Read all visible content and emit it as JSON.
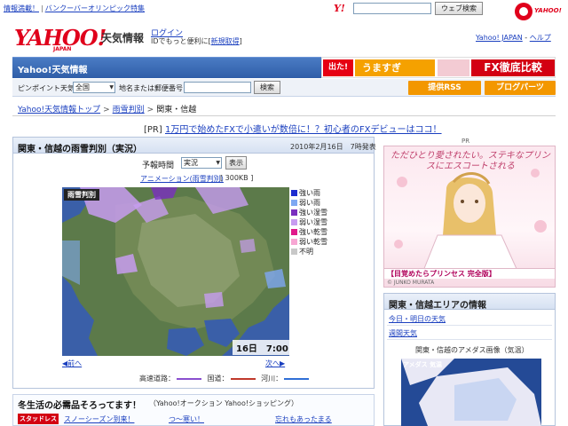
{
  "topbar": {
    "news": [
      "情報満載！",
      "バンクーバーオリンピック特集"
    ],
    "yahoo_small": "Y!",
    "search_button": "ウェブ検索",
    "logo_right_text": "YAHOO!"
  },
  "header": {
    "logo": "YAHOO!",
    "logo_sub": "JAPAN",
    "app_title": "天気情報",
    "login": "ログイン",
    "login_desc_prefix": "IDでもっと便利に[",
    "register": "新規取得",
    "login_desc_suffix": "]",
    "links": [
      "Yahoo! JAPAN",
      "ヘルプ"
    ]
  },
  "bluebar": {
    "title": "Yahoo!天気情報",
    "banner": [
      "出た!",
      "うますぎ",
      "",
      "FX徹底比較"
    ]
  },
  "search": {
    "pin_label": "ピンポイント天気",
    "region": "全国",
    "addr_label": "地名または郵便番号",
    "button": "検索",
    "rss": "提供RSS",
    "blog": "ブログパーツ"
  },
  "breadcrumb": {
    "items": [
      "Yahoo!天気情報トップ",
      "雨雪判別",
      "関東・信越"
    ]
  },
  "pr": {
    "tag": "[PR]",
    "text": "1万円で始めたFXで小遣いが数倍に！？初心者のFXデビューはココ！"
  },
  "panel": {
    "title": "関東・信越の雨雪判別（実況）",
    "date": "2010年2月16日　7時発表",
    "forecast_label": "予報時間",
    "time_value": "実況",
    "show_button": "表示",
    "anim_link": "アニメーション(雨雪判別)",
    "anim_size": "[ 300KB ]",
    "map_label": "雨雪判別",
    "map_time": "16日　7:00",
    "legend": [
      {
        "label": "強い雨",
        "color": "#1d2ccf"
      },
      {
        "label": "弱い雨",
        "color": "#7ea8f2"
      },
      {
        "label": "強い湿雪",
        "color": "#7a2fbf"
      },
      {
        "label": "弱い湿雪",
        "color": "#c79cf0"
      },
      {
        "label": "強い乾雪",
        "color": "#e0188a"
      },
      {
        "label": "弱い乾雪",
        "color": "#f7a6d3"
      },
      {
        "label": "不明",
        "color": "#c8c8c8"
      }
    ],
    "prev": "前へ",
    "next": "次へ",
    "roads": {
      "highway": "高速道路：",
      "national": "国道：",
      "river": "河川："
    },
    "road_colors": {
      "highway": "#8a4fcf",
      "national": "#c0392b",
      "river": "#2f6fd6"
    }
  },
  "promo": {
    "title": "冬生活の必需品そろってます！",
    "sub": "（Yahoo!オークション Yahoo!ショッピング）",
    "badge": "スタッドレス",
    "links": [
      "スノーシーズン到来！",
      "つ〜寒い！",
      "忘れもあったまる"
    ]
  },
  "ad": {
    "pr": "PR",
    "text": "ただひとり愛されたい。ステキなプリンスにエスコートされる",
    "caption": "【目覚めたらプリンセス 完全版】",
    "copy": "© JUNKO MURATA"
  },
  "right_panel": {
    "title": "関東・信越エリアの情報",
    "link1": "今日・明日の天気",
    "link2": "週間天気",
    "amedas_title": "関東・信越のアメダス画像（気温）",
    "amedas_label": "アメダス 気温"
  }
}
